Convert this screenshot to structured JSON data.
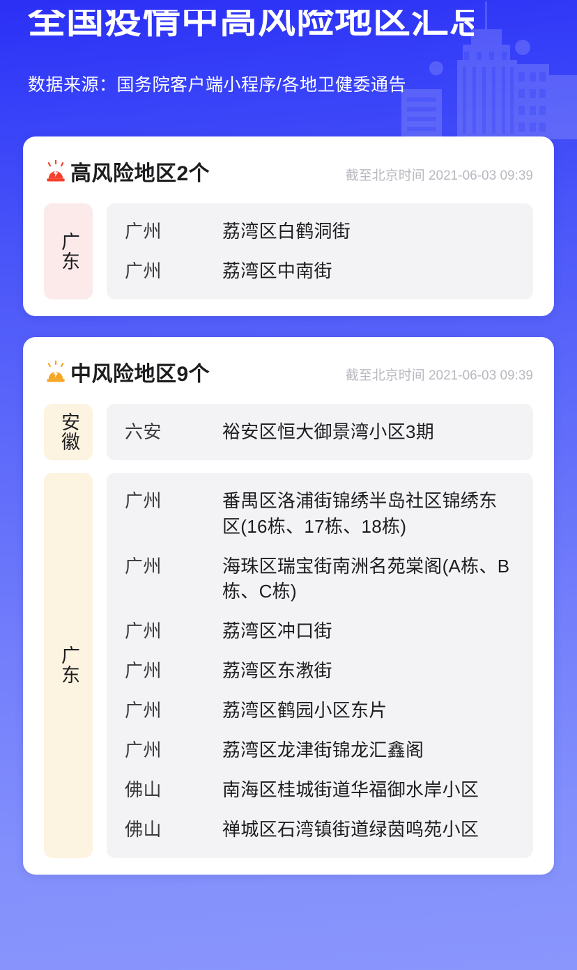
{
  "header": {
    "title_clipped_prefix": "全国疫情中高",
    "title_visible": "风险地区汇总",
    "title_full": "全国疫情中高风险地区汇总",
    "subtitle": "数据来源：国务院客户端小程序/各地卫健委通告",
    "background_color": "#3640f8",
    "background_color_bottom": "#8a96fc"
  },
  "sections": [
    {
      "id": "high-risk",
      "icon": "siren-icon-red",
      "icon_color": "#f5402c",
      "title": "高风险地区2个",
      "count": 2,
      "timestamp": "截至北京时间 2021-06-03 09:39",
      "badge_color": "#fceaeb",
      "groups": [
        {
          "province": "广东",
          "rows": [
            {
              "city": "广州",
              "area": "荔湾区白鹤洞街"
            },
            {
              "city": "广州",
              "area": "荔湾区中南街"
            }
          ]
        }
      ]
    },
    {
      "id": "medium-risk",
      "icon": "siren-icon-orange",
      "icon_color": "#f5a623",
      "title": "中风险地区9个",
      "count": 9,
      "timestamp": "截至北京时间 2021-06-03 09:39",
      "badge_color": "#fdf3e1",
      "groups": [
        {
          "province": "安徽",
          "rows": [
            {
              "city": "六安",
              "area": "裕安区恒大御景湾小区3期"
            }
          ]
        },
        {
          "province": "广东",
          "rows": [
            {
              "city": "广州",
              "area": "番禺区洛浦街锦绣半岛社区锦绣东区(16栋、17栋、18栋)"
            },
            {
              "city": "广州",
              "area": "海珠区瑞宝街南洲名苑棠阁(A栋、B栋、C栋)"
            },
            {
              "city": "广州",
              "area": "荔湾区冲口街"
            },
            {
              "city": "广州",
              "area": "荔湾区东漖街"
            },
            {
              "city": "广州",
              "area": "荔湾区鹤园小区东片"
            },
            {
              "city": "广州",
              "area": "荔湾区龙津街锦龙汇鑫阁"
            },
            {
              "city": "佛山",
              "area": "南海区桂城街道华福御水岸小区"
            },
            {
              "city": "佛山",
              "area": "禅城区石湾镇街道绿茵鸣苑小区"
            }
          ]
        }
      ]
    }
  ]
}
